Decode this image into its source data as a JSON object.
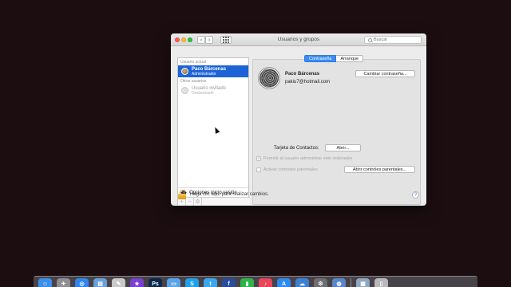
{
  "window": {
    "title": "Usuarios y grupos",
    "search_placeholder": "Buscar"
  },
  "sidebar": {
    "current_user_section": "Usuario actual",
    "current_user": {
      "name": "Paco Bárcenas",
      "role": "Administrador"
    },
    "other_users_section": "Otros usuarios",
    "other_users": [
      {
        "name": "Usuario invitado",
        "role": "Desactivado"
      }
    ],
    "login_options_label": "Opciones inicio sesión",
    "add_symbol": "+",
    "remove_symbol": "−",
    "action_symbol": "⚙"
  },
  "tabs": [
    {
      "label": "Contraseña",
      "active": true
    },
    {
      "label": "Arranque",
      "active": false
    }
  ],
  "user_detail": {
    "full_name": "Paco Bárcenas",
    "email": "pakiu7@hotmail.com",
    "change_password_label": "Cambiar contraseña...",
    "contacts_card_label": "Tarjeta de Contactos:",
    "open_button_label": "Abrir...",
    "allow_admin_label": "Permitir al usuario administrar este ordenador",
    "allow_admin_checked": true,
    "parental_controls_label": "Activar controles parentales",
    "parental_controls_checked": false,
    "open_parental_button_label": "Abrir controles parentales..."
  },
  "footer": {
    "lock_text": "Haga clic aquí para realizar cambios.",
    "help_symbol": "?"
  },
  "colors": {
    "selection": "#1d63d8",
    "active_tab": "#3a8df5",
    "lock": "#e8a629",
    "desktop": "#1c0e10"
  },
  "dock": {
    "items": [
      {
        "icon": "finder-icon",
        "glyph": "☺",
        "color": "#3b8fe8"
      },
      {
        "icon": "launchpad-icon",
        "glyph": "✈",
        "color": "#8e8e93"
      },
      {
        "icon": "safari-icon",
        "glyph": "◎",
        "color": "#2f86f0"
      },
      {
        "icon": "preview-icon",
        "glyph": "▤",
        "color": "#6a9fd8"
      },
      {
        "icon": "textedit-icon",
        "glyph": "✎",
        "color": "#c9c9c9"
      },
      {
        "icon": "imovie-icon",
        "glyph": "★",
        "color": "#7a3fd0"
      },
      {
        "icon": "photoshop-icon",
        "glyph": "Ps",
        "color": "#0b2a4a"
      },
      {
        "icon": "folder-icon",
        "glyph": "▭",
        "color": "#5aa3e8"
      },
      {
        "icon": "skype-icon",
        "glyph": "S",
        "color": "#1fa0e8"
      },
      {
        "icon": "twitter-icon",
        "glyph": "t",
        "color": "#3aa8f0"
      },
      {
        "icon": "facebook-icon",
        "glyph": "f",
        "color": "#2a4d9a"
      },
      {
        "icon": "numbers-icon",
        "glyph": "▮",
        "color": "#2db34a"
      },
      {
        "icon": "music-icon",
        "glyph": "♪",
        "color": "#e8455a"
      },
      {
        "icon": "appstore-icon",
        "glyph": "A",
        "color": "#2f8af0"
      },
      {
        "icon": "finder-app-icon",
        "glyph": "☁",
        "color": "#3d7fd0"
      },
      {
        "icon": "system-preferences-icon",
        "glyph": "⚙",
        "color": "#6e6e72"
      },
      {
        "icon": "network-icon",
        "glyph": "◍",
        "color": "#5a86c8"
      },
      {
        "icon": "downloads-icon",
        "glyph": "▦",
        "color": "#8fa8c0"
      },
      {
        "icon": "trash-icon",
        "glyph": "▯",
        "color": "#b8b8b8"
      }
    ]
  }
}
